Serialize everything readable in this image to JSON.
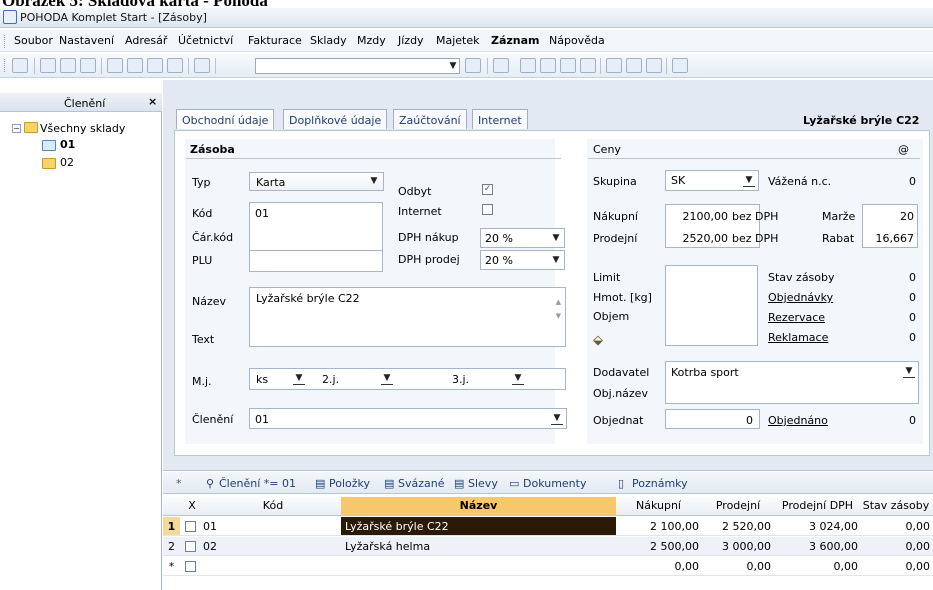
{
  "caption": "Obrázek 5: Skladová karta - Pohoda",
  "window": {
    "title": "POHODA Komplet Start - [Zásoby]"
  },
  "menu": [
    "Soubor",
    "Nastavení",
    "Adresář",
    "Účetnictví",
    "Fakturace",
    "Sklady",
    "Mzdy",
    "Jízdy",
    "Majetek",
    "Záznam",
    "Nápověda"
  ],
  "sidebar": {
    "title": "Členění",
    "close": "×",
    "root": "Všechny sklady",
    "items": [
      "01",
      "02"
    ]
  },
  "tabs": [
    "Obchodní údaje",
    "Doplňkové údaje",
    "Zaúčtování",
    "Internet"
  ],
  "record_title": "Lyžařské brýle C22",
  "zasoba": {
    "heading": "Zásoba",
    "typ_label": "Typ",
    "typ_value": "Karta",
    "kod_label": "Kód",
    "kod_value": "01",
    "carkod_label": "Čár.kód",
    "plu_label": "PLU",
    "odbyt_label": "Odbyt",
    "internet_label": "Internet",
    "dph_nakup_label": "DPH nákup",
    "dph_nakup_value": "20 %",
    "dph_prodej_label": "DPH prodej",
    "dph_prodej_value": "20 %",
    "nazev_label": "Název",
    "nazev_value": "Lyžařské brýle C22",
    "text_label": "Text",
    "mj_label": "M.j.",
    "mj_value": "ks",
    "mj2_label": "2.j.",
    "mj3_label": "3.j.",
    "cleneni_label": "Členění",
    "cleneni_value": "01"
  },
  "ceny": {
    "heading": "Ceny",
    "at": "@",
    "skupina_label": "Skupina",
    "skupina_value": "SK",
    "vazena_label": "Vážená n.c.",
    "vazena_value": "0",
    "nakupni_label": "Nákupní",
    "nakupni_value": "2100,00",
    "nakupni_dph": "bez DPH",
    "marze_label": "Marže",
    "marze_value": "20",
    "prodejni_label": "Prodejní",
    "prodejni_value": "2520,00",
    "prodejni_dph": "bez DPH",
    "rabat_label": "Rabat",
    "rabat_value": "16,667",
    "limit_label": "Limit",
    "hmot_label": "Hmot. [kg]",
    "objem_label": "Objem",
    "stav_label": "Stav zásoby",
    "stav_value": "0",
    "objednavky_label": "Objednávky",
    "objednavky_value": "0",
    "rezervace_label": "Rezervace",
    "rezervace_value": "0",
    "reklamace_label": "Reklamace",
    "reklamace_value": "0",
    "dodavatel_label": "Dodavatel",
    "dodavatel_value": "Kotrba sport",
    "objnazev_label": "Obj.název",
    "objednat_label": "Objednat",
    "objednat_value": "0",
    "objednano_label": "Objednáno",
    "objednano_value": "0"
  },
  "grid_tabs": [
    "Členění *= 01",
    "Položky",
    "Svázané",
    "Slevy",
    "Dokumenty",
    "Poznámky"
  ],
  "grid_columns": [
    "X",
    "Kód",
    "Název",
    "Nákupní",
    "Prodejní",
    "Prodejní DPH",
    "Stav zásoby"
  ],
  "grid_rows": [
    {
      "n": "1",
      "kod": "01",
      "nazev": "Lyžařské brýle C22",
      "nakupni": "2 100,00",
      "prodejni": "2 520,00",
      "prodejni_dph": "3 024,00",
      "stav": "0,00"
    },
    {
      "n": "2",
      "kod": "02",
      "nazev": "Lyžařská helma",
      "nakupni": "2 500,00",
      "prodejni": "3 000,00",
      "prodejni_dph": "3 600,00",
      "stav": "0,00"
    },
    {
      "n": "*",
      "kod": "",
      "nazev": "",
      "nakupni": "0,00",
      "prodejni": "0,00",
      "prodejni_dph": "0,00",
      "stav": "0,00"
    }
  ],
  "colors": {
    "accent": "#1c3f77",
    "selected_name": "#2b1a08",
    "header_name": "#f7c76c"
  }
}
